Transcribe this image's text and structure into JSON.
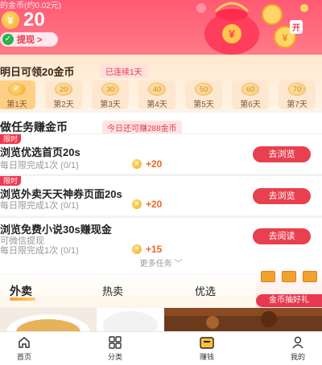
{
  "header": {
    "coin_note": "的金币(约0.02元)",
    "coin_amount": "20",
    "coin_symbol": "¥",
    "withdraw_label": "提现 >",
    "withdraw_icon": "check-icon",
    "bag_tag": "开"
  },
  "checkin": {
    "title": "明日可领20金币",
    "streak": "已连续1天",
    "days": [
      {
        "coin": "✓",
        "label": "第1天"
      },
      {
        "coin": "20",
        "label": "第2天"
      },
      {
        "coin": "30",
        "label": "第3天"
      },
      {
        "coin": "40",
        "label": "第4天"
      },
      {
        "coin": "50",
        "label": "第5天"
      },
      {
        "coin": "60",
        "label": "第6天"
      },
      {
        "coin": "70",
        "label": "第7天"
      }
    ]
  },
  "tasks": {
    "title": "做任务赚金币",
    "badge": "今日还可赚288金币",
    "items": [
      {
        "tag": "限时",
        "title": "浏览优选首页20s",
        "desc": "每日限完成1次  (0/1)",
        "reward": "+20",
        "button": "去浏览"
      },
      {
        "tag": "限时",
        "title": "浏览外卖天天神券页面20s",
        "desc": "每日限完成1次  (0/1)",
        "reward": "+20",
        "button": "去浏览"
      },
      {
        "title": "浏览免费小说30s赚现金",
        "desc": "可微信提现",
        "desc2": "每日限完成1次  (0/1)",
        "reward": "+15",
        "button": "去阅读"
      }
    ],
    "more": "更多任务 ﹀"
  },
  "categories": {
    "tabs": [
      "外卖",
      "热卖",
      "优选"
    ],
    "lottery": "金币抽好礼"
  },
  "nav": {
    "items": [
      {
        "label": "首页",
        "icon": "home-icon"
      },
      {
        "label": "分类",
        "icon": "grid-icon"
      },
      {
        "label": "赚钱",
        "icon": "wallet-icon"
      },
      {
        "label": "我的",
        "icon": "user-icon"
      }
    ]
  },
  "colors": {
    "brand": "#ff5a73",
    "accent": "#e8404f",
    "reward": "#f0652a"
  }
}
